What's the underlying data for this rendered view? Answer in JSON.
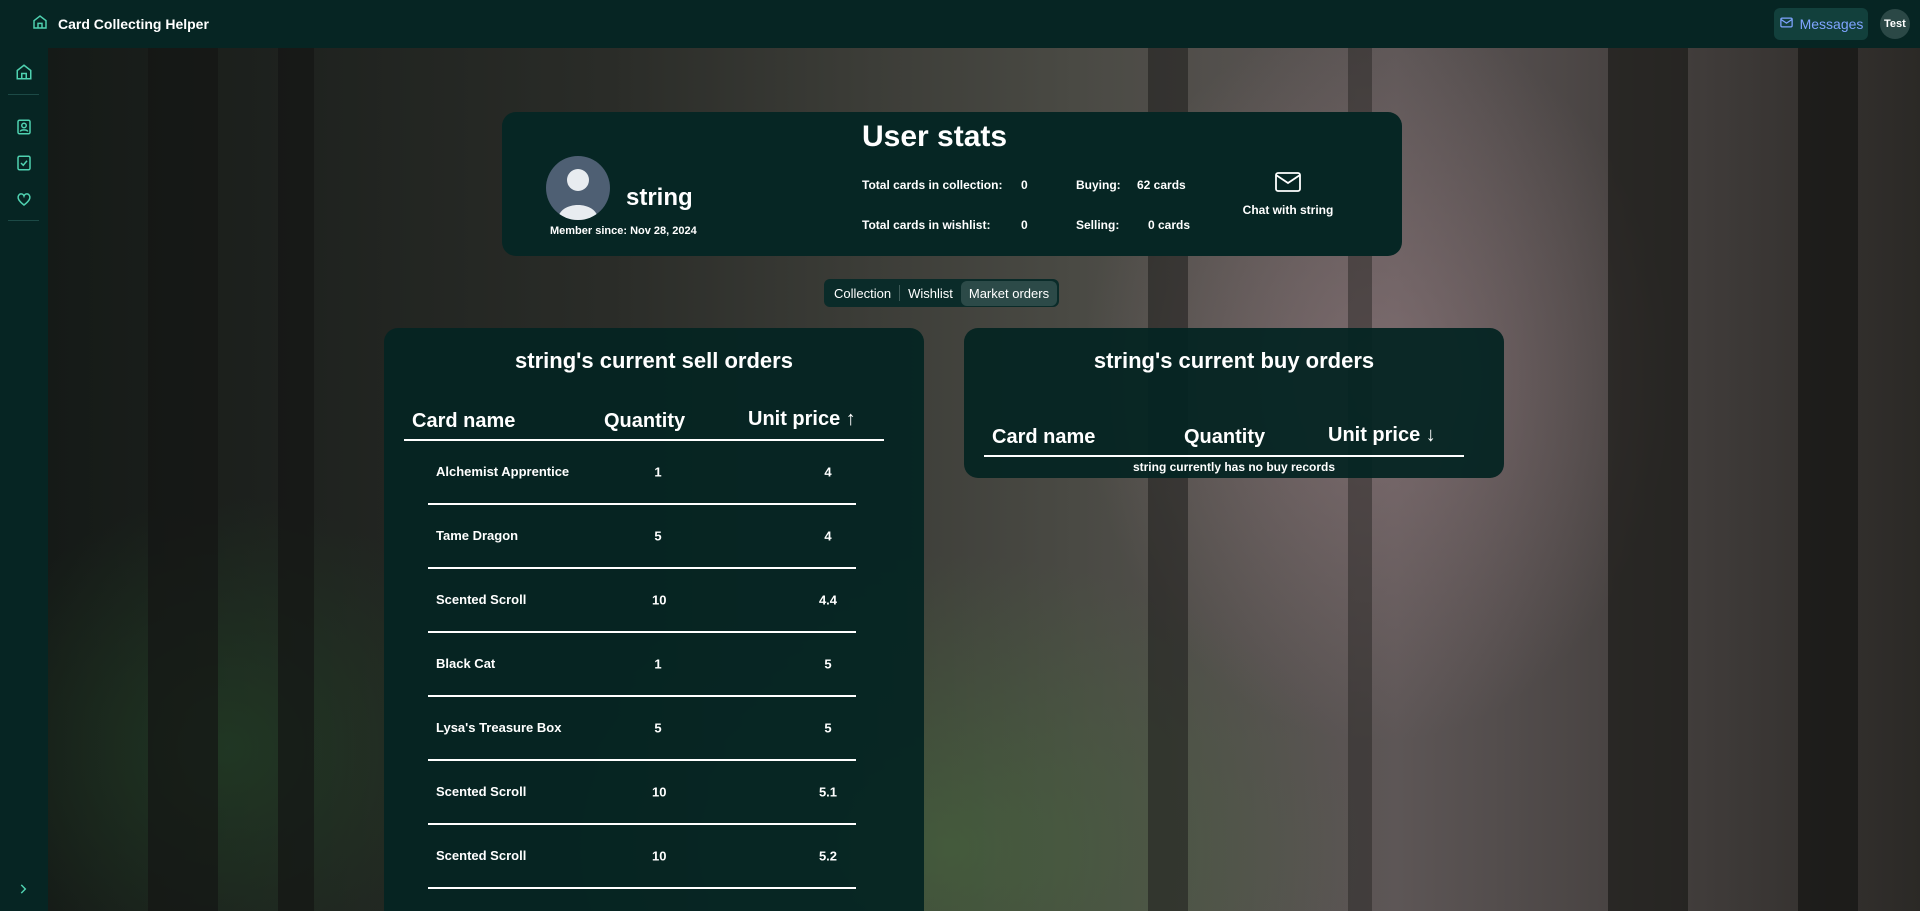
{
  "app": {
    "title": "Card Collecting Helper"
  },
  "header": {
    "messages_label": "Messages",
    "user_badge": "Test"
  },
  "profile": {
    "username": "string",
    "member_since": "Member since: Nov 28, 2024"
  },
  "stats": {
    "title": "User stats",
    "collection_label": "Total cards in collection:",
    "collection_value": "0",
    "wishlist_label": "Total cards in wishlist:",
    "wishlist_value": "0",
    "buying_label": "Buying:",
    "buying_value": "62 cards",
    "selling_label": "Selling:",
    "selling_value": "0 cards",
    "chat_label": "Chat with string"
  },
  "tabs": [
    {
      "label": "Collection"
    },
    {
      "label": "Wishlist"
    },
    {
      "label": "Market orders",
      "active": true
    }
  ],
  "sell_orders": {
    "title": "string's current sell orders",
    "headers": {
      "name": "Card name",
      "qty": "Quantity",
      "price": "Unit price ↑"
    },
    "rows": [
      {
        "name": "Alchemist Apprentice",
        "qty": "1",
        "price": "4"
      },
      {
        "name": "Tame Dragon",
        "qty": "5",
        "price": "4"
      },
      {
        "name": "Scented Scroll",
        "qty": "10",
        "price": "4.4"
      },
      {
        "name": "Black Cat",
        "qty": "1",
        "price": "5"
      },
      {
        "name": "Lysa's Treasure Box",
        "qty": "5",
        "price": "5"
      },
      {
        "name": "Scented Scroll",
        "qty": "10",
        "price": "5.1"
      },
      {
        "name": "Scented Scroll",
        "qty": "10",
        "price": "5.2"
      }
    ]
  },
  "buy_orders": {
    "title": "string's current buy orders",
    "headers": {
      "name": "Card name",
      "qty": "Quantity",
      "price": "Unit price ↓"
    },
    "empty_message": "string currently has no buy records"
  },
  "colors": {
    "accent": "#4fd1b0",
    "panel": "#062624",
    "messages_text": "#7fa4ff"
  }
}
